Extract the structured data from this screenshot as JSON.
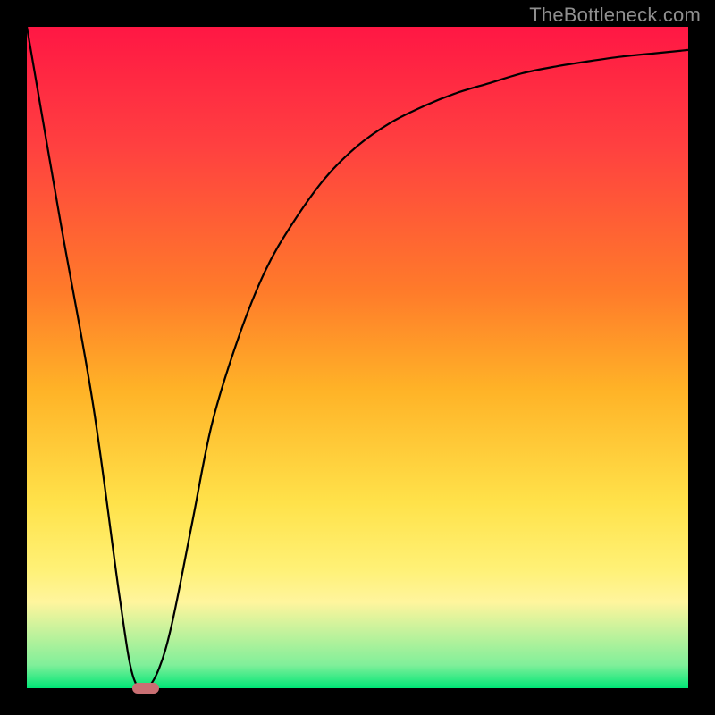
{
  "watermark": "TheBottleneck.com",
  "chart_data": {
    "type": "line",
    "title": "",
    "xlabel": "",
    "ylabel": "",
    "xlim": [
      0,
      100
    ],
    "ylim": [
      0,
      100
    ],
    "grid": false,
    "series": [
      {
        "name": "bottleneck-curve",
        "x": [
          0,
          5,
          10,
          14,
          16,
          18,
          20,
          22,
          25,
          28,
          32,
          36,
          40,
          45,
          50,
          55,
          60,
          65,
          70,
          75,
          80,
          85,
          90,
          95,
          100
        ],
        "y": [
          100,
          71,
          43,
          14,
          2,
          0,
          3,
          10,
          25,
          40,
          53,
          63,
          70,
          77,
          82,
          85.5,
          88,
          90,
          91.5,
          93,
          94,
          94.8,
          95.5,
          96,
          96.5
        ]
      }
    ],
    "marker": {
      "x": 18,
      "y": 0
    },
    "background_gradient": {
      "top": "#ff1744",
      "mid": "#ffe24a",
      "bottom": "#00e676"
    }
  }
}
